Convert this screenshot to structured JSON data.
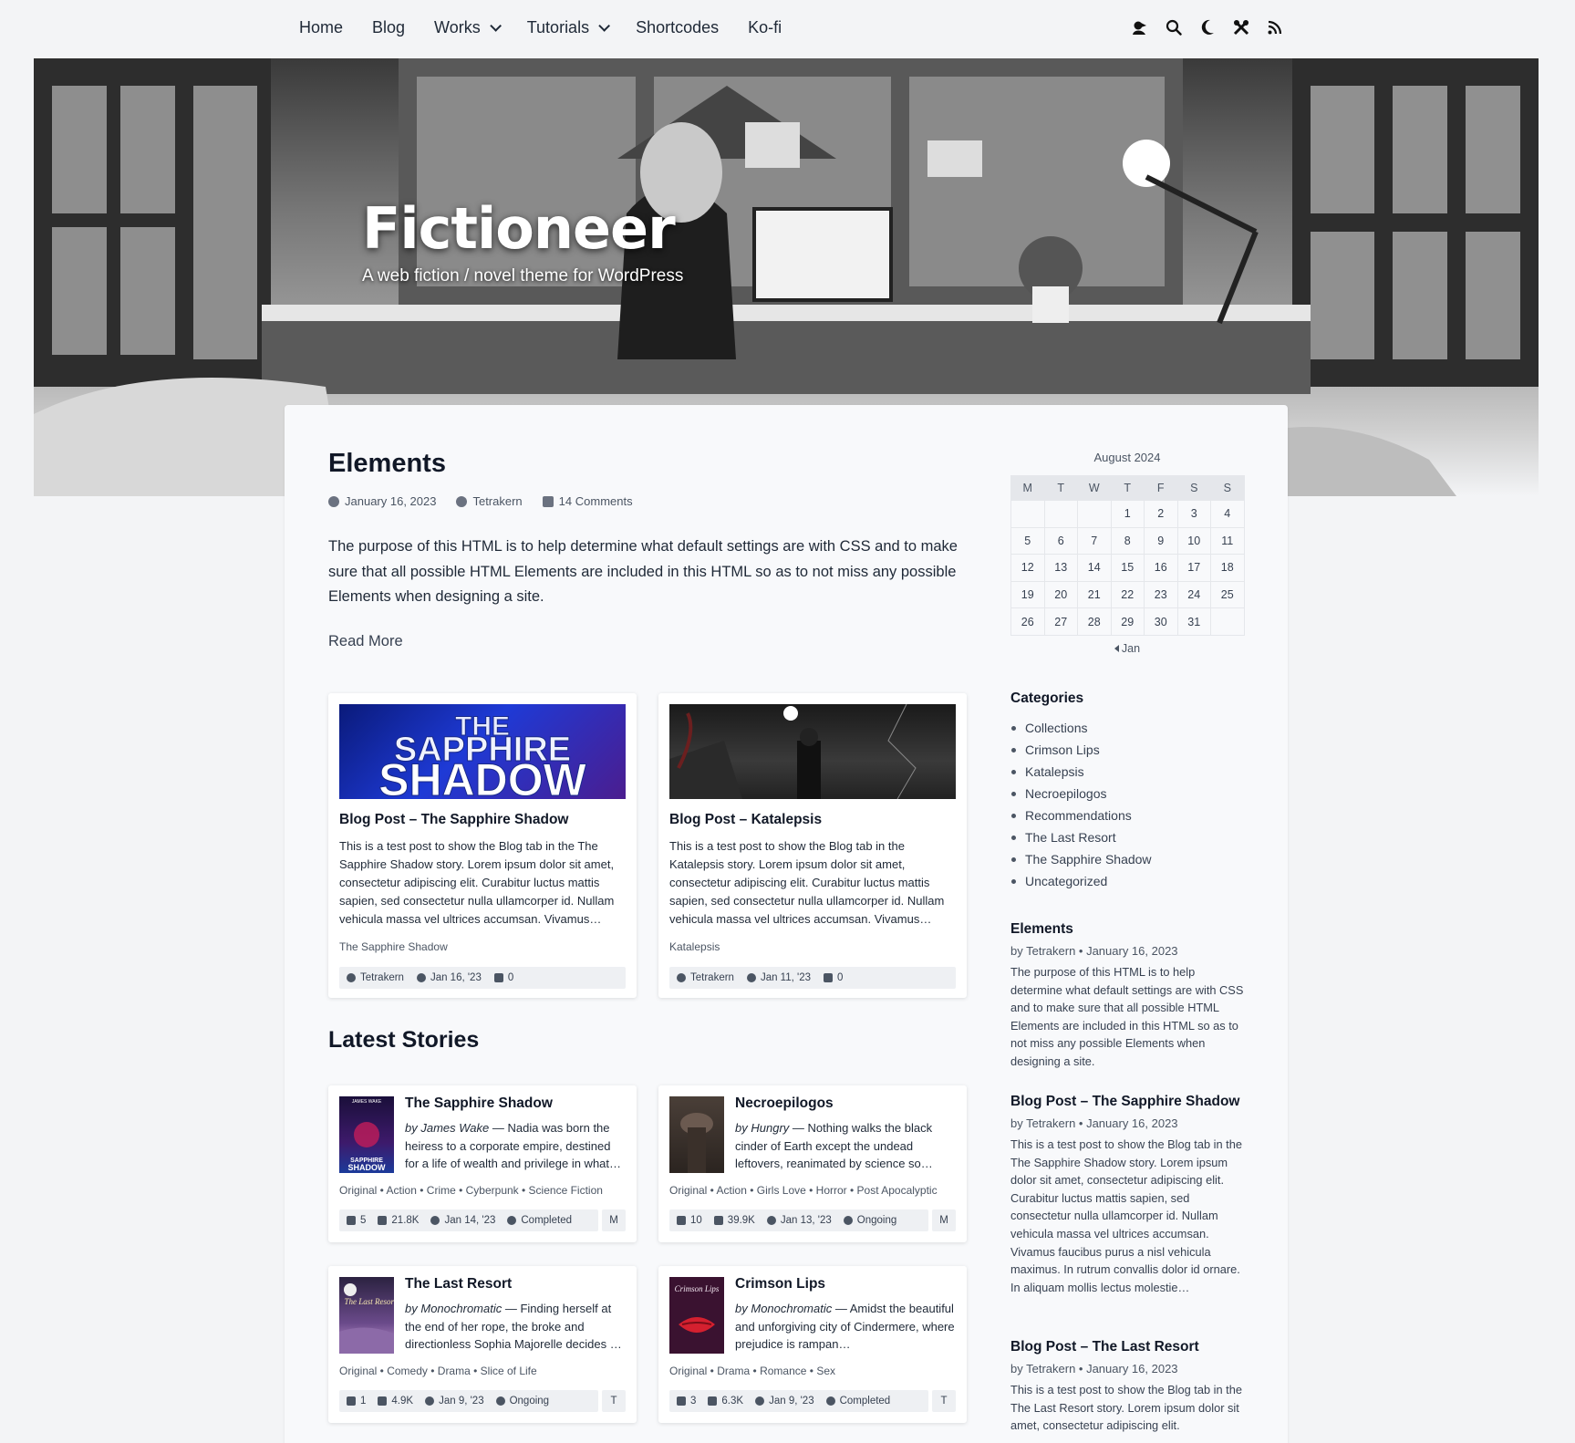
{
  "nav": {
    "items": [
      {
        "label": "Home"
      },
      {
        "label": "Blog"
      },
      {
        "label": "Works",
        "dropdown": true
      },
      {
        "label": "Tutorials",
        "dropdown": true
      },
      {
        "label": "Shortcodes"
      },
      {
        "label": "Ko-fi"
      }
    ],
    "icons": [
      "user-icon",
      "search-icon",
      "moon-icon",
      "tools-icon",
      "rss-icon"
    ]
  },
  "hero": {
    "title": "Fictioneer",
    "tagline": "A web fiction / novel theme for WordPress"
  },
  "post": {
    "title": "Elements",
    "date": "January 16, 2023",
    "author": "Tetrakern",
    "comments": "14 Comments",
    "excerpt": "The purpose of this HTML is to help determine what default settings are with CSS and to make sure that all possible HTML Elements are included in this HTML so as to not miss any possible Elements when designing a site.",
    "read_more": "Read More"
  },
  "blog_cards": [
    {
      "title": "Blog Post – The Sapphire Shadow",
      "thumb_text": "THE SAPPHIRE SHADOW",
      "excerpt": "This is a test post to show the Blog tab in the The Sapphire Shadow story. Lorem ipsum dolor sit amet, consectetur adipiscing elit. Curabitur luctus mattis sapien, sed consectetur nulla ullamcorper id. Nullam vehicula massa vel ultrices accumsan. Vivamus…",
      "story": "The Sapphire Shadow",
      "author": "Tetrakern",
      "date": "Jan 16, '23",
      "comments": "0"
    },
    {
      "title": "Blog Post – Katalepsis",
      "excerpt": "This is a test post to show the Blog tab in the Katalepsis story. Lorem ipsum dolor sit amet, consectetur adipiscing elit. Curabitur luctus mattis sapien, sed consectetur nulla ullamcorper id. Nullam vehicula massa vel ultrices accumsan. Vivamus…",
      "story": "Katalepsis",
      "author": "Tetrakern",
      "date": "Jan 11, '23",
      "comments": "0"
    }
  ],
  "latest_stories": {
    "heading": "Latest Stories",
    "items": [
      {
        "title": "The Sapphire Shadow",
        "author": "James Wake",
        "by": "by",
        "blurb": "Nadia was born the heiress to a corporate empire, destined for a life of wealth and privilege in what…",
        "tags": "Original • Action • Crime • Cyberpunk • Science Fiction",
        "chapters": "5",
        "words": "21.8K",
        "date": "Jan 14, '23",
        "status": "Completed",
        "rating": "M",
        "cover_top": "JAMES WAKE",
        "cover_bottom": "THE SAPPHIRE SHADOW"
      },
      {
        "title": "Necroepilogos",
        "author": "Hungry",
        "by": "by",
        "blurb": "Nothing walks the black cinder of Earth except the undead leftovers, reanimated by science so…",
        "tags": "Original • Action • Girls Love • Horror • Post Apocalyptic",
        "chapters": "10",
        "words": "39.9K",
        "date": "Jan 13, '23",
        "status": "Ongoing",
        "rating": "M"
      },
      {
        "title": "The Last Resort",
        "author": "Monochromatic",
        "by": "by",
        "blurb": "Finding herself at the end of her rope, the broke and directionless Sophia Majorelle decides …",
        "tags": "Original • Comedy • Drama • Slice of Life",
        "chapters": "1",
        "words": "4.9K",
        "date": "Jan 9, '23",
        "status": "Ongoing",
        "rating": "T",
        "cover_text": "The Last Resort"
      },
      {
        "title": "Crimson Lips",
        "author": "Monochromatic",
        "by": "by",
        "blurb": "Amidst the beautiful and unforgiving city of Cindermere, where prejudice is rampan…",
        "tags": "Original • Drama • Romance • Sex",
        "chapters": "3",
        "words": "6.3K",
        "date": "Jan 9, '23",
        "status": "Completed",
        "rating": "T",
        "cover_text": "Crimson Lips"
      }
    ]
  },
  "calendar": {
    "caption": "August 2024",
    "weekdays": [
      "M",
      "T",
      "W",
      "T",
      "F",
      "S",
      "S"
    ],
    "weeks": [
      [
        "",
        "",
        "",
        "1",
        "2",
        "3",
        "4"
      ],
      [
        "5",
        "6",
        "7",
        "8",
        "9",
        "10",
        "11"
      ],
      [
        "12",
        "13",
        "14",
        "15",
        "16",
        "17",
        "18"
      ],
      [
        "19",
        "20",
        "21",
        "22",
        "23",
        "24",
        "25"
      ],
      [
        "26",
        "27",
        "28",
        "29",
        "30",
        "31",
        ""
      ]
    ],
    "prev": "Jan"
  },
  "categories": {
    "title": "Categories",
    "items": [
      "Collections",
      "Crimson Lips",
      "Katalepsis",
      "Necroepilogos",
      "Recommendations",
      "The Last Resort",
      "The Sapphire Shadow",
      "Uncategorized"
    ]
  },
  "recent_posts": [
    {
      "title": "Elements",
      "meta": "by Tetrakern • January 16, 2023",
      "excerpt": "The purpose of this HTML is to help determine what default settings are with CSS and to make sure that all possible HTML Elements are included in this HTML so as to not miss any possible Elements when designing a site."
    },
    {
      "title": "Blog Post – The Sapphire Shadow",
      "meta": "by Tetrakern • January 16, 2023",
      "excerpt": "This is a test post to show the Blog tab in the The Sapphire Shadow story. Lorem ipsum dolor sit amet, consectetur adipiscing elit. Curabitur luctus mattis sapien, sed consectetur nulla ullamcorper id. Nullam vehicula massa vel ultrices accumsan. Vivamus faucibus purus a nisl vehicula maximus. In rutrum convallis dolor id ornare. In aliquam mollis lectus molestie…"
    },
    {
      "title": "Blog Post – The Last Resort",
      "meta": "by Tetrakern • January 16, 2023",
      "excerpt": "This is a test post to show the Blog tab in the The Last Resort story. Lorem ipsum dolor sit amet, consectetur adipiscing elit."
    }
  ]
}
